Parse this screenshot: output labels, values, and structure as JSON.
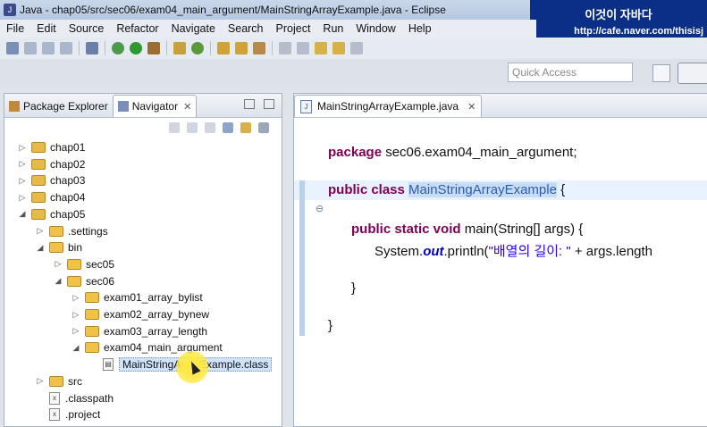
{
  "window": {
    "title": "Java - chap05/src/sec06/exam04_main_argument/MainStringArrayExample.java - Eclipse"
  },
  "watermark": {
    "line1": "이것이 자바다",
    "line2": "http://cafe.naver.com/thisisj"
  },
  "menu": [
    "File",
    "Edit",
    "Source",
    "Refactor",
    "Navigate",
    "Search",
    "Project",
    "Run",
    "Window",
    "Help"
  ],
  "quick_access": {
    "placeholder": "Quick Access"
  },
  "left_tabs": [
    {
      "label": "Package Explorer"
    },
    {
      "label": "Navigator",
      "close": "✕"
    }
  ],
  "tree": [
    {
      "label": "chap01",
      "twisty": "▷",
      "depth": 0,
      "kind": "project"
    },
    {
      "label": "chap02",
      "twisty": "▷",
      "depth": 0,
      "kind": "project"
    },
    {
      "label": "chap03",
      "twisty": "▷",
      "depth": 0,
      "kind": "project"
    },
    {
      "label": "chap04",
      "twisty": "▷",
      "depth": 0,
      "kind": "project"
    },
    {
      "label": "chap05",
      "twisty": "◢",
      "depth": 0,
      "kind": "project"
    },
    {
      "label": ".settings",
      "twisty": "▷",
      "depth": 1,
      "kind": "folder"
    },
    {
      "label": "bin",
      "twisty": "◢",
      "depth": 1,
      "kind": "folder"
    },
    {
      "label": "sec05",
      "twisty": "▷",
      "depth": 2,
      "kind": "folder"
    },
    {
      "label": "sec06",
      "twisty": "◢",
      "depth": 2,
      "kind": "folder"
    },
    {
      "label": "exam01_array_bylist",
      "twisty": "▷",
      "depth": 3,
      "kind": "folder"
    },
    {
      "label": "exam02_array_bynew",
      "twisty": "▷",
      "depth": 3,
      "kind": "folder"
    },
    {
      "label": "exam03_array_length",
      "twisty": "▷",
      "depth": 3,
      "kind": "folder"
    },
    {
      "label": "exam04_main_argument",
      "twisty": "◢",
      "depth": 3,
      "kind": "folder"
    },
    {
      "label": "MainStringArrayExample.class",
      "twisty": "",
      "depth": 4,
      "kind": "classfile",
      "selected": true
    },
    {
      "label": "src",
      "twisty": "▷",
      "depth": 1,
      "kind": "folder"
    },
    {
      "label": ".classpath",
      "twisty": "",
      "depth": 1,
      "kind": "file"
    },
    {
      "label": ".project",
      "twisty": "",
      "depth": 1,
      "kind": "file"
    }
  ],
  "editor": {
    "tab_label": "MainStringArrayExample.java",
    "tab_close": "✕",
    "code": {
      "pkg_kw": "package",
      "pkg_name": " sec06.exam04_main_argument;",
      "cls_kw": "public class ",
      "cls_name": "MainStringArrayExample",
      "cls_open": " {",
      "main_kw": "public static void",
      "main_rest": " main(String[] args) {",
      "sys": "System.",
      "out": "out",
      "println": ".println(",
      "str": "\"배열의 길이: \"",
      "tail": " + args.length",
      "close_inner": "}",
      "close_outer": "}"
    }
  },
  "colors": {
    "keyword": "#7f0055",
    "string": "#2a00ff",
    "selection": "#c8ddf5"
  }
}
